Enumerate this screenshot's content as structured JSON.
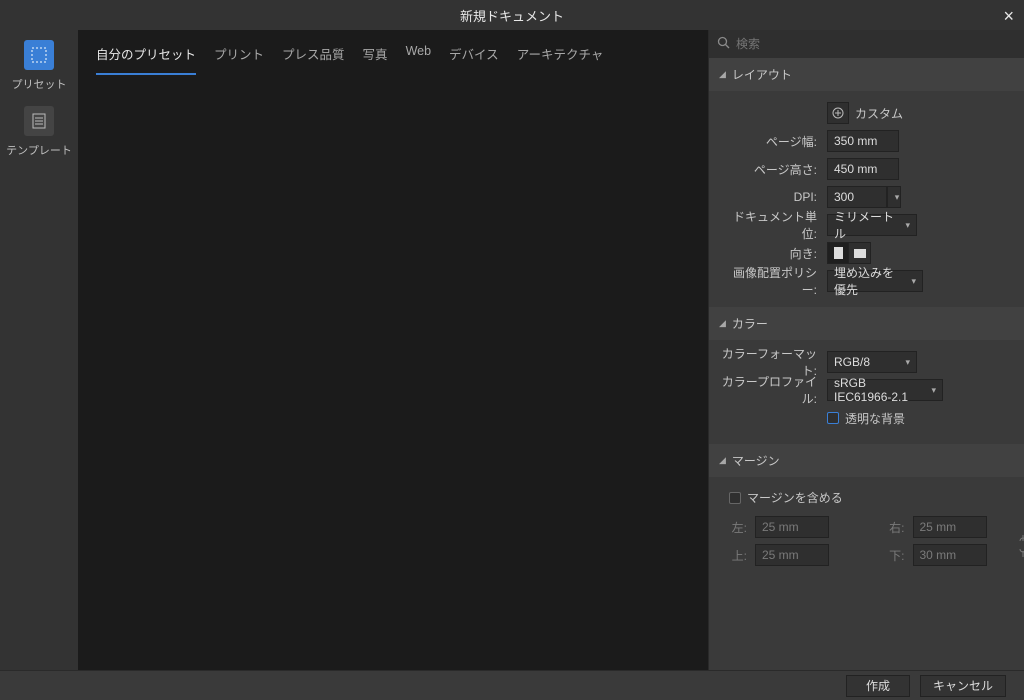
{
  "title": "新規ドキュメント",
  "sidebar": {
    "preset": "プリセット",
    "template": "テンプレート"
  },
  "tabs": [
    "自分のプリセット",
    "プリント",
    "プレス品質",
    "写真",
    "Web",
    "デバイス",
    "アーキテクチャ"
  ],
  "search": {
    "placeholder": "検索"
  },
  "sections": {
    "layout": "レイアウト",
    "color": "カラー",
    "margin": "マージン"
  },
  "layout": {
    "custom": "カスタム",
    "page_width_label": "ページ幅:",
    "page_width": "350 mm",
    "page_height_label": "ページ高さ:",
    "page_height": "450 mm",
    "dpi_label": "DPI:",
    "dpi": "300",
    "unit_label": "ドキュメント単位:",
    "unit": "ミリメートル",
    "orientation_label": "向き:",
    "image_policy_label": "画像配置ポリシー:",
    "image_policy": "埋め込みを優先"
  },
  "color": {
    "format_label": "カラーフォーマット:",
    "format": "RGB/8",
    "profile_label": "カラープロファイル:",
    "profile": "sRGB IEC61966-2.1",
    "transparent_bg": "透明な背景"
  },
  "margin": {
    "include": "マージンを含める",
    "left_label": "左:",
    "left": "25 mm",
    "right_label": "右:",
    "right": "25 mm",
    "top_label": "上:",
    "top": "25 mm",
    "bottom_label": "下:",
    "bottom": "30 mm"
  },
  "footer": {
    "create": "作成",
    "cancel": "キャンセル"
  }
}
